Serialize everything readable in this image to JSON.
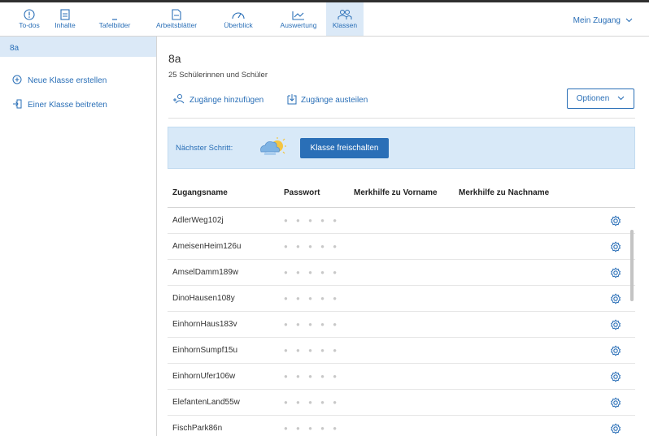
{
  "nav": {
    "items": [
      {
        "label": "To-dos",
        "icon": "info-circle-icon"
      },
      {
        "label": "Inhalte",
        "icon": "document-icon"
      },
      {
        "label": "Tafelbilder",
        "icon": "board-icon"
      },
      {
        "label": "Arbeitsblätter",
        "icon": "worksheet-icon"
      },
      {
        "label": "Überblick",
        "icon": "gauge-icon"
      },
      {
        "label": "Auswertung",
        "icon": "chart-icon"
      },
      {
        "label": "Klassen",
        "icon": "people-icon"
      }
    ],
    "active": "Klassen",
    "account_label": "Mein Zugang",
    "accent": "#2a6fb7"
  },
  "sidebar": {
    "current_class": "8a",
    "actions": [
      {
        "label": "Neue Klasse erstellen",
        "icon": "plus-circle-icon"
      },
      {
        "label": "Einer Klasse beitreten",
        "icon": "join-icon"
      }
    ]
  },
  "main": {
    "title": "8a",
    "subtitle": "25 Schülerinnen und Schüler",
    "add_access_label": "Zugänge hinzufügen",
    "distribute_access_label": "Zugänge austeilen",
    "options_label": "Optionen",
    "next_step_label": "Nächster Schritt:",
    "next_step_button": "Klasse freischalten"
  },
  "table": {
    "headers": [
      "Zugangsname",
      "Passwort",
      "Merkhilfe zu Vorname",
      "Merkhilfe zu Nachname"
    ],
    "password_mask": "● ● ● ● ●",
    "rows": [
      "AdlerWeg102j",
      "AmeisenHeim126u",
      "AmselDamm189w",
      "DinoHausen108y",
      "EinhornHaus183v",
      "EinhornSumpf15u",
      "EinhornUfer106w",
      "ElefantenLand55w",
      "FischPark86n"
    ]
  }
}
